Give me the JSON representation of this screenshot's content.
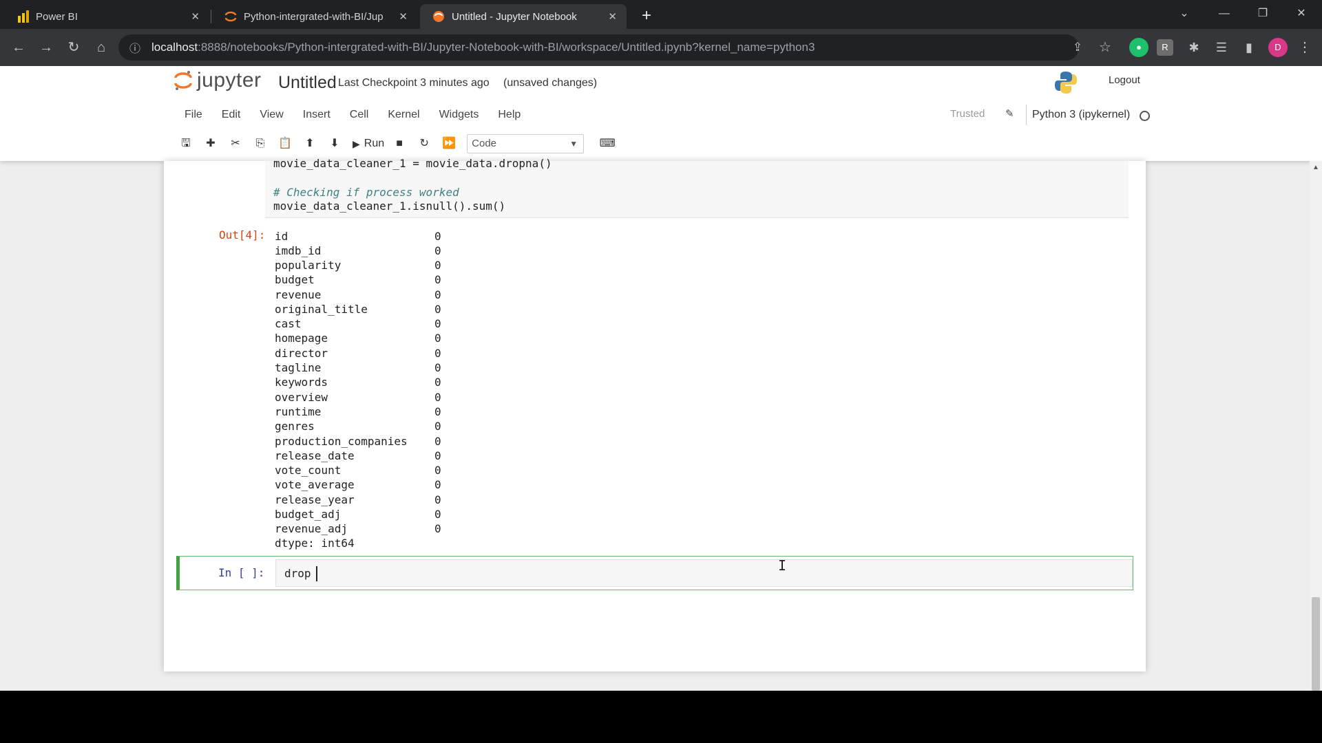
{
  "browser": {
    "tabs": [
      {
        "label": "Power BI",
        "icon": "power-bi-icon",
        "color": "#f2c811"
      },
      {
        "label": "Python-intergrated-with-BI/Jup",
        "icon": "jupyter-tab-icon",
        "color": "#f37726"
      },
      {
        "label": "Untitled - Jupyter Notebook",
        "icon": "jupyter-tab-icon",
        "color": "#f37726"
      }
    ],
    "close_glyph": "✕",
    "new_tab_glyph": "+",
    "url_host": "localhost",
    "url_rest": ":8888/notebooks/Python-intergrated-with-BI/Jupyter-Notebook-with-BI/workspace/Untitled.ipynb?kernel_name=python3",
    "profile_initial": "D",
    "ext_r_label": "R"
  },
  "jupyter": {
    "brand": "jupyter",
    "notebook_title": "Untitled",
    "checkpoint": "Last Checkpoint  3 minutes ago",
    "unsaved": "(unsaved changes)",
    "logout": "Logout",
    "menus": [
      "File",
      "Edit",
      "View",
      "Insert",
      "Cell",
      "Kernel",
      "Widgets",
      "Help"
    ],
    "trusted": "Trusted",
    "kernel": "Python 3 (ipykernel)",
    "run_label": "Run",
    "cell_type": "Code"
  },
  "cells": {
    "code_lines": [
      "movie_data_cleaner_1 = movie_data.dropna()",
      "",
      "# Checking if process worked",
      "movie_data_cleaner_1.isnull().sum()"
    ],
    "out_prompt": "Out[4]:",
    "output_rows": [
      [
        "id",
        "0"
      ],
      [
        "imdb_id",
        "0"
      ],
      [
        "popularity",
        "0"
      ],
      [
        "budget",
        "0"
      ],
      [
        "revenue",
        "0"
      ],
      [
        "original_title",
        "0"
      ],
      [
        "cast",
        "0"
      ],
      [
        "homepage",
        "0"
      ],
      [
        "director",
        "0"
      ],
      [
        "tagline",
        "0"
      ],
      [
        "keywords",
        "0"
      ],
      [
        "overview",
        "0"
      ],
      [
        "runtime",
        "0"
      ],
      [
        "genres",
        "0"
      ],
      [
        "production_companies",
        "0"
      ],
      [
        "release_date",
        "0"
      ],
      [
        "vote_count",
        "0"
      ],
      [
        "vote_average",
        "0"
      ],
      [
        "release_year",
        "0"
      ],
      [
        "budget_adj",
        "0"
      ],
      [
        "revenue_adj",
        "0"
      ]
    ],
    "dtype": "dtype: int64",
    "in_prompt": "In [ ]:",
    "active_input": "drop "
  }
}
